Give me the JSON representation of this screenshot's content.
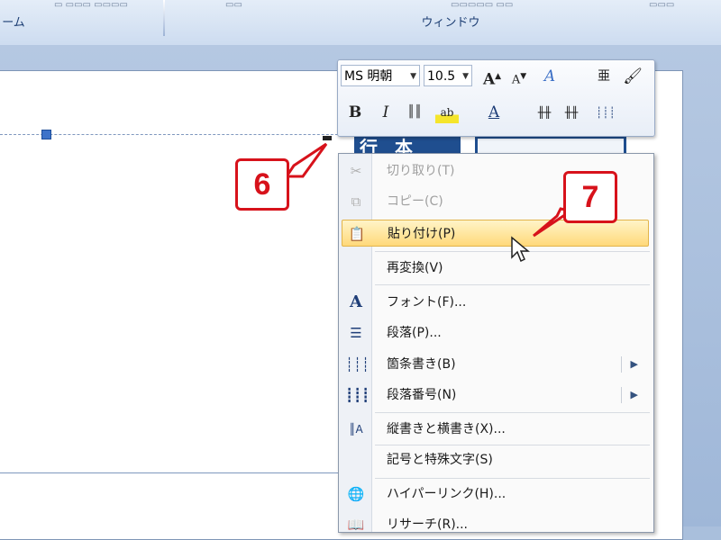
{
  "ribbon": {
    "left_group_label": "ーム",
    "right_group_label": "ウィンドウ"
  },
  "mini_toolbar": {
    "font_name": "MS 明朝",
    "font_size": "10.5",
    "grow_font_icon": "A˄",
    "shrink_font_icon": "A˅",
    "bold_label": "B",
    "italic_label": "I"
  },
  "title_box_text": "行 本",
  "context_menu": {
    "items": [
      {
        "label": "切り取り(T)",
        "icon": "scissors-icon",
        "disabled": true
      },
      {
        "label": "コピー(C)",
        "icon": "copy-icon",
        "disabled": true
      },
      {
        "label": "貼り付け(P)",
        "icon": "paste-icon",
        "highlighted": true
      },
      {
        "label": "再変換(V)",
        "icon": ""
      },
      {
        "label": "フォント(F)...",
        "icon": "font-icon"
      },
      {
        "label": "段落(P)...",
        "icon": "paragraph-icon"
      },
      {
        "label": "箇条書き(B)",
        "icon": "bullets-icon",
        "submenu": true
      },
      {
        "label": "段落番号(N)",
        "icon": "numbering-icon",
        "submenu": true
      },
      {
        "label": "縦書きと横書き(X)...",
        "icon": "text-direction-icon"
      },
      {
        "label": "記号と特殊文字(S)",
        "icon": ""
      },
      {
        "label": "ハイパーリンク(H)...",
        "icon": "hyperlink-icon"
      },
      {
        "label": "リサーチ(R)...",
        "icon": "research-icon"
      }
    ]
  },
  "callouts": {
    "step6": "6",
    "step7": "7"
  },
  "colors": {
    "callout_red": "#d7121b",
    "highlight": "#ffd97a",
    "title_fill": "#1f4e8f"
  }
}
